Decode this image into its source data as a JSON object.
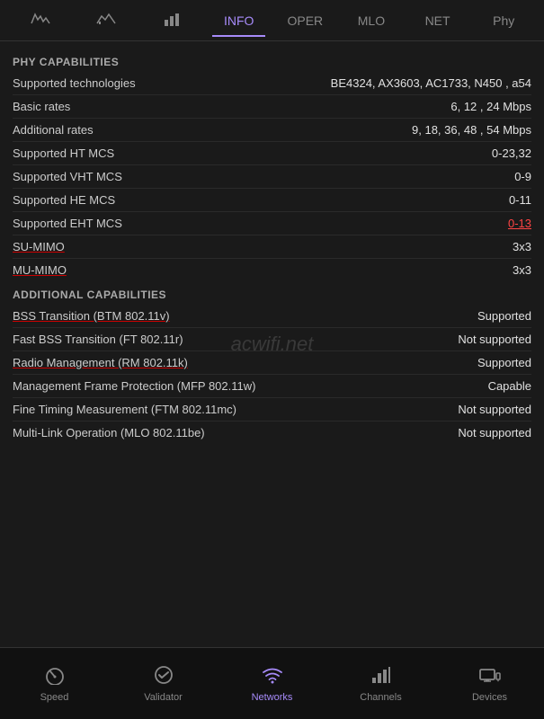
{
  "tabs": [
    {
      "id": "tab-wave",
      "label": "~",
      "icon": "〜",
      "active": false
    },
    {
      "id": "tab-chart",
      "label": "chart",
      "icon": "⊡",
      "active": false
    },
    {
      "id": "tab-bar",
      "label": "bar",
      "icon": "▐",
      "active": false
    },
    {
      "id": "tab-info",
      "label": "INFO",
      "icon": "",
      "active": true
    },
    {
      "id": "tab-oper",
      "label": "OPER",
      "icon": "",
      "active": false
    },
    {
      "id": "tab-mlo",
      "label": "MLO",
      "icon": "",
      "active": false
    },
    {
      "id": "tab-net",
      "label": "NET",
      "icon": "",
      "active": false
    },
    {
      "id": "tab-phy",
      "label": "Phy",
      "icon": "",
      "active": false
    }
  ],
  "sections": [
    {
      "id": "phy-capabilities",
      "header": "PHY CAPABILITIES",
      "rows": [
        {
          "id": "supported-tech",
          "label": "Supported technologies",
          "value": "BE4324, AX3603, AC1733, N450 , a54",
          "label_underline": false,
          "value_style": "normal"
        },
        {
          "id": "basic-rates",
          "label": "Basic rates",
          "value": "6, 12 , 24 Mbps",
          "label_underline": false,
          "value_style": "normal"
        },
        {
          "id": "additional-rates",
          "label": "Additional rates",
          "value": "9, 18, 36, 48 , 54 Mbps",
          "label_underline": false,
          "value_style": "normal"
        },
        {
          "id": "ht-mcs",
          "label": "Supported HT MCS",
          "value": "0-23,32",
          "label_underline": false,
          "value_style": "normal"
        },
        {
          "id": "vht-mcs",
          "label": "Supported VHT MCS",
          "value": "0-9",
          "label_underline": false,
          "value_style": "normal"
        },
        {
          "id": "he-mcs",
          "label": "Supported HE MCS",
          "value": "0-11",
          "label_underline": false,
          "value_style": "normal"
        },
        {
          "id": "eht-mcs",
          "label": "Supported EHT MCS",
          "value": "0-13",
          "label_underline": false,
          "value_style": "red"
        },
        {
          "id": "su-mimo",
          "label": "SU-MIMO",
          "value": "3x3",
          "label_underline": true,
          "value_style": "normal"
        },
        {
          "id": "mu-mimo",
          "label": "MU-MIMO",
          "value": "3x3",
          "label_underline": true,
          "value_style": "normal"
        }
      ]
    },
    {
      "id": "additional-capabilities",
      "header": "ADDITIONAL CAPABILITIES",
      "rows": [
        {
          "id": "bss-transition",
          "label": "BSS Transition (BTM 802.11v)",
          "value": "Supported",
          "label_underline": true,
          "value_style": "normal"
        },
        {
          "id": "fast-bss",
          "label": "Fast BSS Transition (FT 802.11r)",
          "value": "Not supported",
          "label_underline": false,
          "value_style": "normal"
        },
        {
          "id": "radio-mgmt",
          "label": "Radio Management (RM 802.11k)",
          "value": "Supported",
          "label_underline": true,
          "value_style": "normal"
        },
        {
          "id": "mfp",
          "label": "Management Frame Protection (MFP 802.11w)",
          "value": "Capable",
          "label_underline": false,
          "value_style": "normal"
        },
        {
          "id": "ftm",
          "label": "Fine Timing Measurement (FTM 802.11mc)",
          "value": "Not supported",
          "label_underline": false,
          "value_style": "normal"
        },
        {
          "id": "mlo",
          "label": "Multi-Link Operation (MLO 802.11be)",
          "value": "Not supported",
          "label_underline": false,
          "value_style": "normal"
        }
      ]
    }
  ],
  "watermark": "acwifi.net",
  "bottom_nav": [
    {
      "id": "nav-speed",
      "label": "Speed",
      "icon": "speed",
      "active": false
    },
    {
      "id": "nav-validator",
      "label": "Validator",
      "icon": "check",
      "active": false
    },
    {
      "id": "nav-networks",
      "label": "Networks",
      "icon": "wifi",
      "active": true
    },
    {
      "id": "nav-channels",
      "label": "Channels",
      "icon": "bars",
      "active": false
    },
    {
      "id": "nav-devices",
      "label": "Devices",
      "icon": "devices",
      "active": false
    }
  ]
}
